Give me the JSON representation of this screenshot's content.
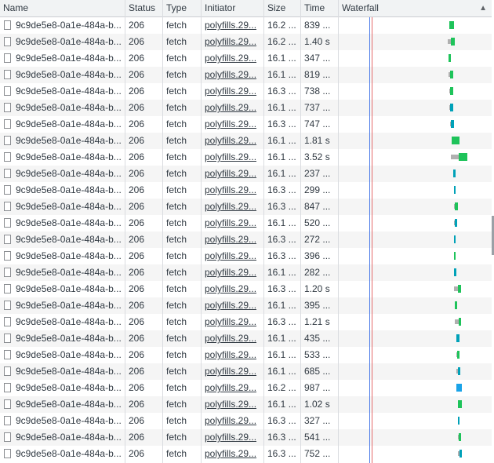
{
  "columns": {
    "name": "Name",
    "status": "Status",
    "type": "Type",
    "initiator": "Initiator",
    "size": "Size",
    "time": "Time",
    "waterfall": "Waterfall"
  },
  "sort_indicator": "▲",
  "colors": {
    "bar_green": "#1ec35a",
    "bar_teal": "#00a1b8",
    "bar_blue": "#1aa3e8",
    "wait_gray": "#b0b0b0",
    "dcl_line": "#4a7ae8",
    "load_line": "#e46a6a"
  },
  "rows": [
    {
      "name": "9c9de5e8-0a1e-484a-b...",
      "status": "206",
      "type": "fetch",
      "initiator": "polyfills.29...",
      "size": "16.2 ...",
      "time": "839 ..."
    },
    {
      "name": "9c9de5e8-0a1e-484a-b...",
      "status": "206",
      "type": "fetch",
      "initiator": "polyfills.29...",
      "size": "16.2 ...",
      "time": "1.40 s"
    },
    {
      "name": "9c9de5e8-0a1e-484a-b...",
      "status": "206",
      "type": "fetch",
      "initiator": "polyfills.29...",
      "size": "16.1 ...",
      "time": "347 ..."
    },
    {
      "name": "9c9de5e8-0a1e-484a-b...",
      "status": "206",
      "type": "fetch",
      "initiator": "polyfills.29...",
      "size": "16.1 ...",
      "time": "819 ..."
    },
    {
      "name": "9c9de5e8-0a1e-484a-b...",
      "status": "206",
      "type": "fetch",
      "initiator": "polyfills.29...",
      "size": "16.3 ...",
      "time": "738 ..."
    },
    {
      "name": "9c9de5e8-0a1e-484a-b...",
      "status": "206",
      "type": "fetch",
      "initiator": "polyfills.29...",
      "size": "16.1 ...",
      "time": "737 ..."
    },
    {
      "name": "9c9de5e8-0a1e-484a-b...",
      "status": "206",
      "type": "fetch",
      "initiator": "polyfills.29...",
      "size": "16.3 ...",
      "time": "747 ..."
    },
    {
      "name": "9c9de5e8-0a1e-484a-b...",
      "status": "206",
      "type": "fetch",
      "initiator": "polyfills.29...",
      "size": "16.1 ...",
      "time": "1.81 s"
    },
    {
      "name": "9c9de5e8-0a1e-484a-b...",
      "status": "206",
      "type": "fetch",
      "initiator": "polyfills.29...",
      "size": "16.1 ...",
      "time": "3.52 s"
    },
    {
      "name": "9c9de5e8-0a1e-484a-b...",
      "status": "206",
      "type": "fetch",
      "initiator": "polyfills.29...",
      "size": "16.1 ...",
      "time": "237 ..."
    },
    {
      "name": "9c9de5e8-0a1e-484a-b...",
      "status": "206",
      "type": "fetch",
      "initiator": "polyfills.29...",
      "size": "16.3 ...",
      "time": "299 ..."
    },
    {
      "name": "9c9de5e8-0a1e-484a-b...",
      "status": "206",
      "type": "fetch",
      "initiator": "polyfills.29...",
      "size": "16.3 ...",
      "time": "847 ..."
    },
    {
      "name": "9c9de5e8-0a1e-484a-b...",
      "status": "206",
      "type": "fetch",
      "initiator": "polyfills.29...",
      "size": "16.1 ...",
      "time": "520 ..."
    },
    {
      "name": "9c9de5e8-0a1e-484a-b...",
      "status": "206",
      "type": "fetch",
      "initiator": "polyfills.29...",
      "size": "16.3 ...",
      "time": "272 ..."
    },
    {
      "name": "9c9de5e8-0a1e-484a-b...",
      "status": "206",
      "type": "fetch",
      "initiator": "polyfills.29...",
      "size": "16.3 ...",
      "time": "396 ..."
    },
    {
      "name": "9c9de5e8-0a1e-484a-b...",
      "status": "206",
      "type": "fetch",
      "initiator": "polyfills.29...",
      "size": "16.1 ...",
      "time": "282 ..."
    },
    {
      "name": "9c9de5e8-0a1e-484a-b...",
      "status": "206",
      "type": "fetch",
      "initiator": "polyfills.29...",
      "size": "16.3 ...",
      "time": "1.20 s"
    },
    {
      "name": "9c9de5e8-0a1e-484a-b...",
      "status": "206",
      "type": "fetch",
      "initiator": "polyfills.29...",
      "size": "16.1 ...",
      "time": "395 ..."
    },
    {
      "name": "9c9de5e8-0a1e-484a-b...",
      "status": "206",
      "type": "fetch",
      "initiator": "polyfills.29...",
      "size": "16.3 ...",
      "time": "1.21 s"
    },
    {
      "name": "9c9de5e8-0a1e-484a-b...",
      "status": "206",
      "type": "fetch",
      "initiator": "polyfills.29...",
      "size": "16.1 ...",
      "time": "435 ..."
    },
    {
      "name": "9c9de5e8-0a1e-484a-b...",
      "status": "206",
      "type": "fetch",
      "initiator": "polyfills.29...",
      "size": "16.1 ...",
      "time": "533 ..."
    },
    {
      "name": "9c9de5e8-0a1e-484a-b...",
      "status": "206",
      "type": "fetch",
      "initiator": "polyfills.29...",
      "size": "16.1 ...",
      "time": "685 ..."
    },
    {
      "name": "9c9de5e8-0a1e-484a-b...",
      "status": "206",
      "type": "fetch",
      "initiator": "polyfills.29...",
      "size": "16.2 ...",
      "time": "987 ..."
    },
    {
      "name": "9c9de5e8-0a1e-484a-b...",
      "status": "206",
      "type": "fetch",
      "initiator": "polyfills.29...",
      "size": "16.1 ...",
      "time": "1.02 s"
    },
    {
      "name": "9c9de5e8-0a1e-484a-b...",
      "status": "206",
      "type": "fetch",
      "initiator": "polyfills.29...",
      "size": "16.3 ...",
      "time": "327 ..."
    },
    {
      "name": "9c9de5e8-0a1e-484a-b...",
      "status": "206",
      "type": "fetch",
      "initiator": "polyfills.29...",
      "size": "16.3 ...",
      "time": "541 ..."
    },
    {
      "name": "9c9de5e8-0a1e-484a-b...",
      "status": "206",
      "type": "fetch",
      "initiator": "polyfills.29...",
      "size": "16.3 ...",
      "time": "752 ..."
    }
  ]
}
